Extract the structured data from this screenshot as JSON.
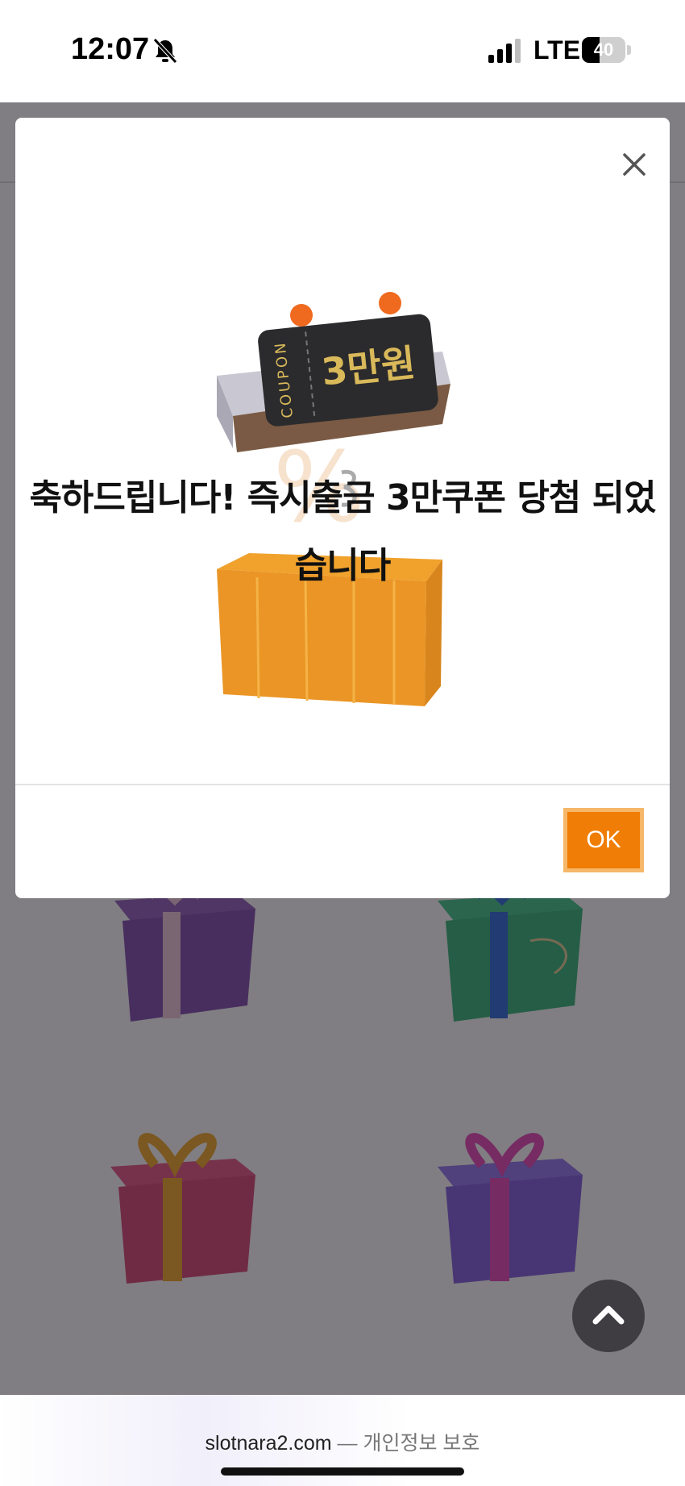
{
  "status_bar": {
    "time": "12:07",
    "network": "LTE",
    "battery_level": "40",
    "battery_fraction": 0.4
  },
  "modal": {
    "hero_coupon_vertical_text": "COUPON",
    "hero_coupon_amount": "3만원",
    "message": "축하드립니다! 즉시출금 3만쿠폰 당첨 되었습니다",
    "ok_label": "OK"
  },
  "bottom_bar": {
    "url": "slotnara2.com",
    "separator": " — ",
    "privacy_label": "개인정보 보호"
  },
  "colors": {
    "accent": "#f07d05",
    "accent_border": "#f6b768",
    "overlay": "rgba(36,32,40,0.58)"
  },
  "icons": {
    "close": "close-icon",
    "scroll_top": "chevron-up-icon",
    "mute": "bell-slash-icon",
    "signal": "signal-bars-icon",
    "battery": "battery-icon"
  }
}
